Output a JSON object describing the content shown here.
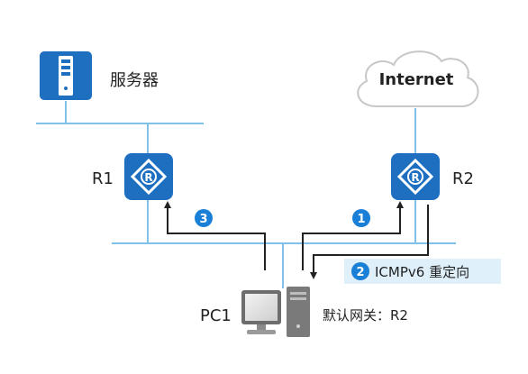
{
  "nodes": {
    "server": {
      "label": "服务器"
    },
    "internet": {
      "label": "Internet"
    },
    "r1": {
      "label": "R1"
    },
    "r2": {
      "label": "R2"
    },
    "pc1": {
      "label": "PC1",
      "gateway": "默认网关：R2"
    }
  },
  "steps": [
    {
      "number": "1"
    },
    {
      "number": "2",
      "label": "ICMPv6 重定向"
    },
    {
      "number": "3"
    }
  ],
  "colors": {
    "line": "#7fc1e7",
    "router": "#1e6fc0",
    "badge": "#1a7fd6",
    "arrow": "#222222",
    "redirect_box": "#dff0fb"
  }
}
